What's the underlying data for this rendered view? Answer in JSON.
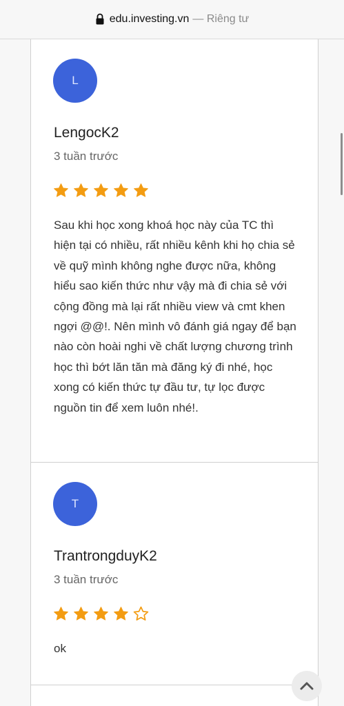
{
  "browser": {
    "domain": "edu.investing.vn",
    "suffix": "— Riêng tư"
  },
  "reviews": [
    {
      "initial": "L",
      "name": "LengocK2",
      "time": "3 tuần trước",
      "rating": 5,
      "text": "Sau khi học xong khoá học này của TC thì hiện tại có nhiều, rất nhiều kênh khi họ chia sẻ về quỹ mình không nghe được nữa, không hiểu sao kiến thức như vậy mà đi chia sẻ với cộng đồng mà lại rất nhiều view và cmt khen ngợi @@!. Nên mình vô đánh giá ngay để bạn nào còn hoài nghi về chất lượng chương trình học thì bớt lăn tăn mà đăng ký đi nhé, học xong có kiến thức tự đầu tư, tự lọc được nguồn tin để xem luôn nhé!."
    },
    {
      "initial": "T",
      "name": "TrantrongduyK2",
      "time": "3 tuần trước",
      "rating": 4,
      "text": "ok"
    }
  ],
  "colors": {
    "avatar": "#3c63da",
    "star": "#f39c12"
  },
  "icons": {
    "lock": "lock-icon",
    "star_filled": "star-filled-icon",
    "star_empty": "star-empty-icon",
    "scroll_top": "chevron-up-icon"
  }
}
